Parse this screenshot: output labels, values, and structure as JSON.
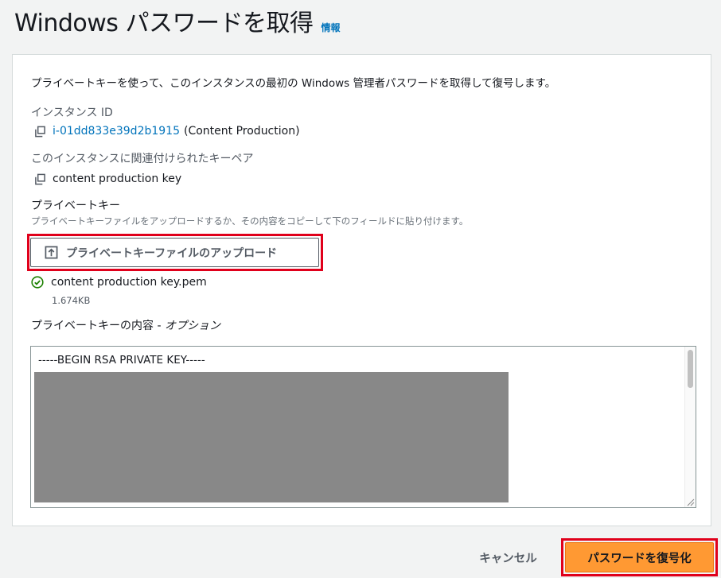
{
  "header": {
    "title": "Windows パスワードを取得",
    "info_link": "情報"
  },
  "panel": {
    "description": "プライベートキーを使って、このインスタンスの最初の Windows 管理者パスワードを取得して復号します。",
    "instance": {
      "label": "インスタンス ID",
      "id": "i-01dd833e39d2b1915",
      "name": "(Content Production)"
    },
    "key_pair": {
      "label": "このインスタンスに関連付けられたキーペア",
      "value": "content production key"
    },
    "private_key": {
      "label": "プライベートキー",
      "hint": "プライベートキーファイルをアップロードするか、その内容をコピーして下のフィールドに貼り付けます。",
      "upload_button": "プライベートキーファイルのアップロード",
      "file_name": "content production key.pem",
      "file_size": "1.674KB"
    },
    "contents": {
      "label": "プライベートキーの内容 - ",
      "label_optional": "オプション",
      "value": "-----BEGIN RSA PRIVATE KEY-----"
    }
  },
  "footer": {
    "cancel_label": "キャンセル",
    "decrypt_label": "パスワードを復号化"
  },
  "colors": {
    "link": "#0073bb",
    "primary": "#ff9933",
    "highlight": "#e0001b",
    "success": "#1d8102"
  }
}
